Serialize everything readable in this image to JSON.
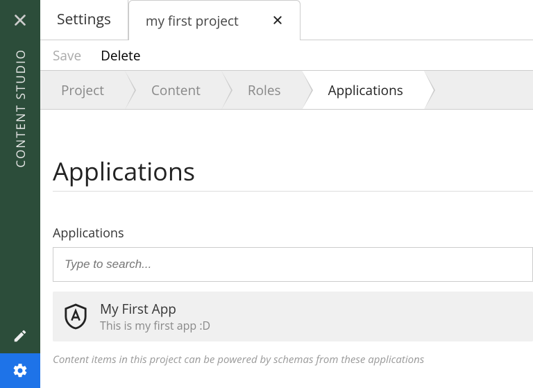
{
  "sidebar": {
    "title": "CONTENT STUDIO"
  },
  "tabs": {
    "settings_label": "Settings",
    "active_label": "my first project"
  },
  "actions": {
    "save": "Save",
    "delete": "Delete"
  },
  "wizard": {
    "steps": [
      "Project",
      "Content",
      "Roles",
      "Applications"
    ],
    "active_index": 3
  },
  "page": {
    "heading": "Applications",
    "field_label": "Applications",
    "search_placeholder": "Type to search...",
    "hint": "Content items in this project can be powered by schemas from these applications"
  },
  "apps": [
    {
      "name": "My First App",
      "desc": "This is my first app :D"
    }
  ]
}
